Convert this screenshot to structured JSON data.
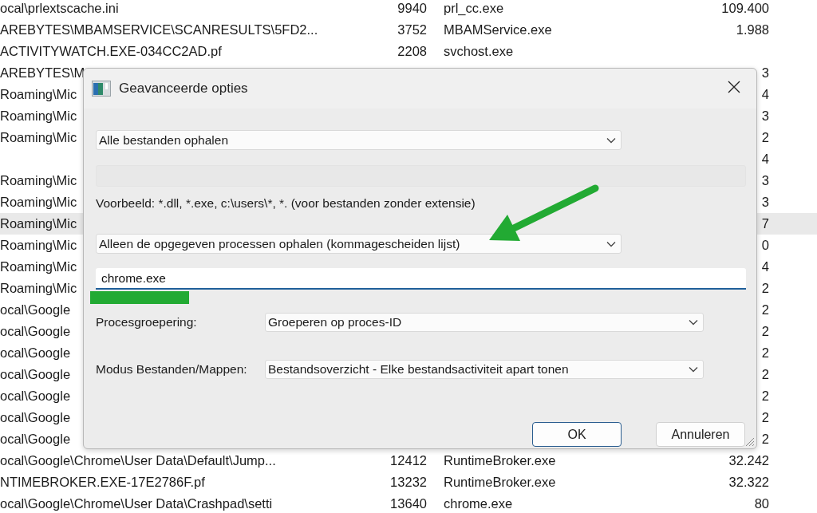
{
  "background_table": {
    "rows": [
      {
        "column_1": "ocal\\prlextscache.ini",
        "column_2": "9940",
        "column_3": "prl_cc.exe",
        "column_4": "109.400",
        "selected": false
      },
      {
        "column_1": "AREBYTES\\MBAMSERVICE\\SCANRESULTS\\5FD2...",
        "column_2": "3752",
        "column_3": "MBAMService.exe",
        "column_4": "1.988",
        "selected": false
      },
      {
        "column_1": "ACTIVITYWATCH.EXE-034CC2AD.pf",
        "column_2": "2208",
        "column_3": "svchost.exe",
        "selected": false
      },
      {
        "column_1": "AREBYTES\\M",
        "column_4": "3",
        "selected": false
      },
      {
        "column_1": "Roaming\\Mic",
        "column_4": "4",
        "selected": false
      },
      {
        "column_1": "Roaming\\Mic",
        "column_4": "3",
        "selected": false
      },
      {
        "column_1": "Roaming\\Mic",
        "column_4": "2",
        "selected": false
      },
      {
        "column_4": "4",
        "selected": false
      },
      {
        "column_1": "Roaming\\Mic",
        "column_4": "3",
        "selected": false
      },
      {
        "column_1": "Roaming\\Mic",
        "column_4": "3",
        "selected": false
      },
      {
        "column_1": "Roaming\\Mic",
        "column_4": "7",
        "selected": true
      },
      {
        "column_1": "Roaming\\Mic",
        "column_4": "0",
        "selected": false
      },
      {
        "column_1": "Roaming\\Mic",
        "column_4": "4",
        "selected": false
      },
      {
        "column_1": "Roaming\\Mic",
        "column_4": "2",
        "selected": false
      },
      {
        "column_1": "ocal\\Google",
        "column_4": "2",
        "selected": false
      },
      {
        "column_1": "ocal\\Google",
        "column_4": "2",
        "selected": false
      },
      {
        "column_1": "ocal\\Google",
        "column_4": "2",
        "selected": false
      },
      {
        "column_1": "ocal\\Google",
        "column_4": "2",
        "selected": false
      },
      {
        "column_1": "ocal\\Google",
        "column_4": "2",
        "selected": false
      },
      {
        "column_1": "ocal\\Google",
        "column_4": "2",
        "selected": false
      },
      {
        "column_1": "ocal\\Google",
        "column_4": "2",
        "selected": false
      },
      {
        "column_1": "ocal\\Google\\Chrome\\User Data\\Default\\Jump...",
        "column_2": "12412",
        "column_3": "RuntimeBroker.exe",
        "column_4": "32.242",
        "selected": false
      },
      {
        "column_1": "NTIMEBROKER.EXE-17E2786F.pf",
        "column_2": "13232",
        "column_3": "RuntimeBroker.exe",
        "column_4": "32.322",
        "selected": false
      },
      {
        "column_1": "ocal\\Google\\Chrome\\User Data\\Crashpad\\setti",
        "column_2": "13640",
        "column_3": "chrome.exe",
        "column_4": "80",
        "selected": false
      }
    ]
  },
  "dialog": {
    "title": "Geavanceerde opties",
    "file_filter": {
      "value": "Alle bestanden ophalen"
    },
    "file_pattern": {
      "disabled": true
    },
    "example": "Voorbeeld: *.dll, *.exe, c:\\users\\*, *. (voor bestanden zonder extensie)",
    "process_filter": {
      "value": "Alleen de opgegeven processen ophalen (kommagescheiden lijst)"
    },
    "process_list": {
      "value": "chrome.exe",
      "focused": true
    },
    "options": [
      {
        "label": "Procesgroepering:",
        "value": "Groeperen op proces-ID"
      },
      {
        "label": "Modus Bestanden/Mappen:",
        "value": "Bestandsoverzicht - Elke bestandsactiviteit apart tonen"
      }
    ],
    "buttons": [
      {
        "label": "OK",
        "default": true
      },
      {
        "label": "Annuleren",
        "default": false
      }
    ]
  }
}
